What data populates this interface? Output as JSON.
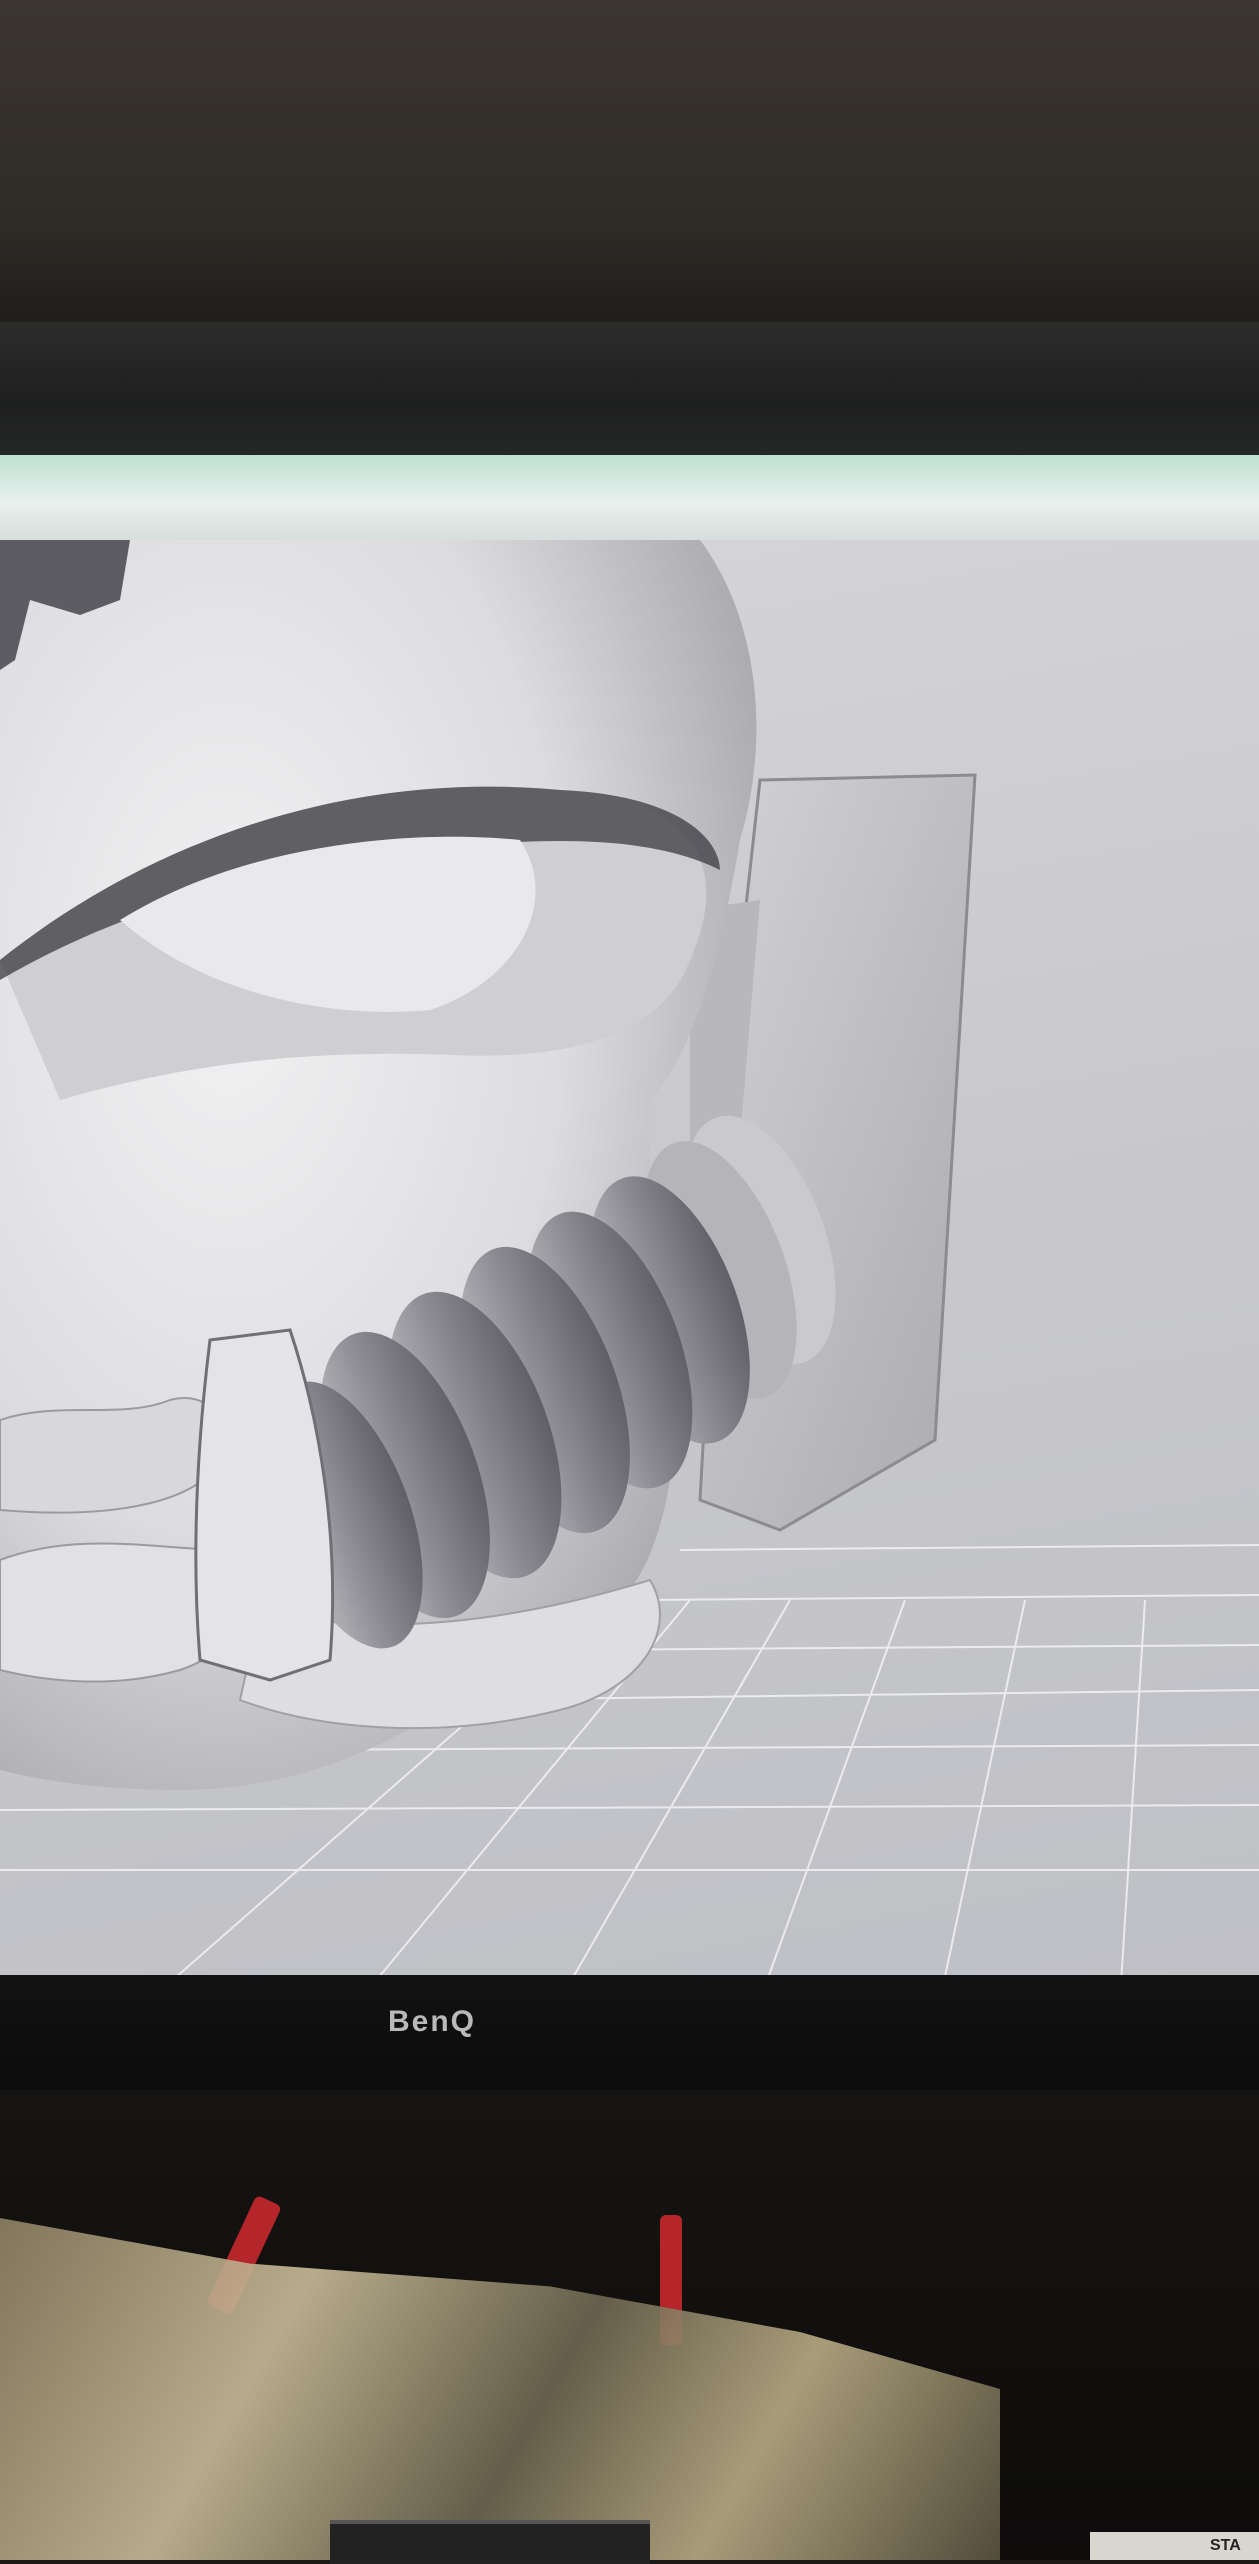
{
  "monitor": {
    "brand": "BenQ"
  },
  "desk": {
    "ruler_text": "STA"
  },
  "colors": {
    "model_surface": "#e6e6e8",
    "viewport_background": "#c9c9cd",
    "grid_lines": "#f4f4f6",
    "bezel": "#121212"
  }
}
